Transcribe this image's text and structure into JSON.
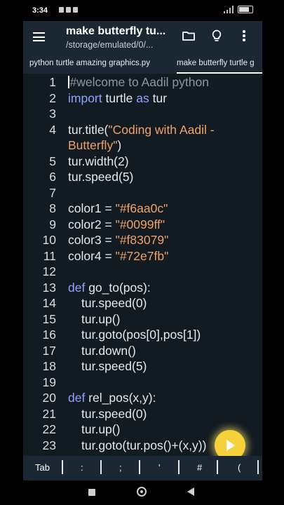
{
  "status_bar": {
    "time": "3:34"
  },
  "app_bar": {
    "title": "make butterfly tu...",
    "path": "/storage/emulated/0/..."
  },
  "tabs": [
    {
      "label": "python turtle amazing graphics.py",
      "active": false
    },
    {
      "label": "make butterfly turtle g",
      "active": true
    }
  ],
  "editor": {
    "lines": [
      {
        "n": "1",
        "text": "#welcome to Aadil python"
      },
      {
        "n": "2",
        "text": "import turtle as tur"
      },
      {
        "n": "3",
        "text": ""
      },
      {
        "n": "4",
        "text": "tur.title(\"Coding with Aadil -"
      },
      {
        "n": "",
        "text": "Butterfly\")"
      },
      {
        "n": "5",
        "text": "tur.width(2)"
      },
      {
        "n": "6",
        "text": "tur.speed(5)"
      },
      {
        "n": "7",
        "text": ""
      },
      {
        "n": "8",
        "text": "color1 = \"#f6aa0c\""
      },
      {
        "n": "9",
        "text": "color2 = \"#0099ff\""
      },
      {
        "n": "10",
        "text": "color3 = \"#f83079\""
      },
      {
        "n": "11",
        "text": "color4 = \"#72e7fb\""
      },
      {
        "n": "12",
        "text": ""
      },
      {
        "n": "13",
        "text": "def go_to(pos):"
      },
      {
        "n": "14",
        "text": "tur.speed(0)"
      },
      {
        "n": "15",
        "text": "tur.up()"
      },
      {
        "n": "16",
        "text": "tur.goto(pos[0],pos[1])"
      },
      {
        "n": "17",
        "text": "tur.down()"
      },
      {
        "n": "18",
        "text": "tur.speed(5)"
      },
      {
        "n": "19",
        "text": ""
      },
      {
        "n": "20",
        "text": "def rel_pos(x,y):"
      },
      {
        "n": "21",
        "text": "tur.speed(0)"
      },
      {
        "n": "22",
        "text": "tur.up()"
      },
      {
        "n": "23",
        "text": "tur.goto(tur.pos()+(x,y))"
      }
    ]
  },
  "symbols": [
    "Tab",
    ":",
    ";",
    "'",
    "#",
    "("
  ],
  "colors": {
    "background": "#121a22",
    "bar": "#1b2733",
    "keyword": "#8ea3ff",
    "string": "#f0a267",
    "comment": "#8d97a0",
    "fab": "#f5d23a"
  }
}
